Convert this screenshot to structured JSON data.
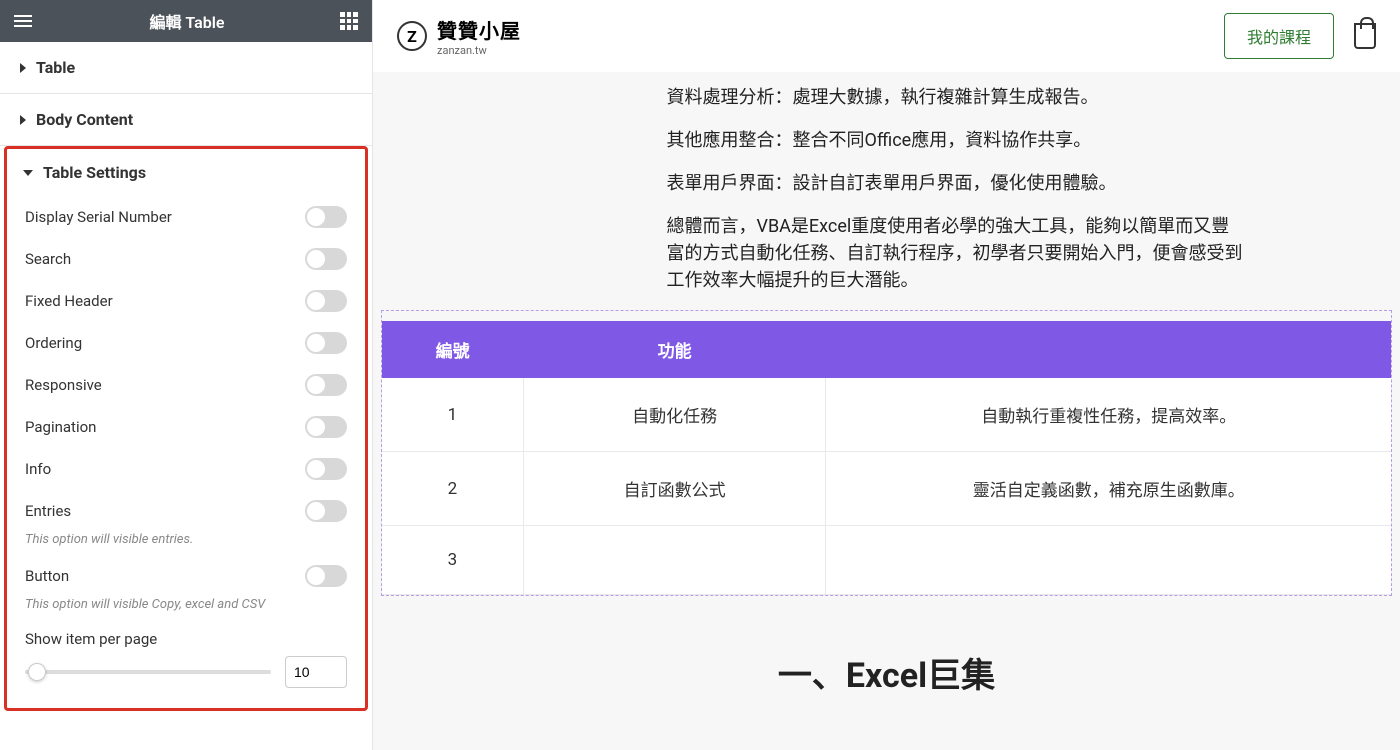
{
  "sidebar": {
    "title": "編輯 Table",
    "sections": {
      "table": "Table",
      "body_content": "Body Content",
      "table_settings": "Table Settings"
    },
    "settings": {
      "display_serial": "Display Serial Number",
      "search": "Search",
      "fixed_header": "Fixed Header",
      "ordering": "Ordering",
      "responsive": "Responsive",
      "pagination": "Pagination",
      "info": "Info",
      "entries": "Entries",
      "entries_help": "This option will visible entries.",
      "button": "Button",
      "button_help": "This option will visible Copy, excel and CSV",
      "show_per_page": "Show item per page",
      "per_page_value": "10"
    }
  },
  "topbar": {
    "brand_title": "贊贊小屋",
    "brand_sub": "zanzan.tw",
    "my_courses": "我的課程"
  },
  "article": {
    "p1": "資料處理分析：處理大數據，執行複雜計算生成報告。",
    "p2": "其他應用整合：整合不同Office應用，資料協作共享。",
    "p3": "表單用戶界面：設計自訂表單用戶界面，優化使用體驗。",
    "p4": "總體而言，VBA是Excel重度使用者必學的強大工具，能夠以簡單而又豐富的方式自動化任務、自訂執行程序，初學者只要開始入門，便會感受到工作效率大幅提升的巨大潛能。"
  },
  "table": {
    "headers": {
      "no": "編號",
      "func": "功能",
      "desc": ""
    },
    "rows": [
      {
        "no": "1",
        "func": "自動化任務",
        "desc": "自動執行重複性任務，提高效率。"
      },
      {
        "no": "2",
        "func": "自訂函數公式",
        "desc": "靈活自定義函數，補充原生函數庫。"
      },
      {
        "no": "3",
        "func": "",
        "desc": ""
      }
    ]
  },
  "section_title": "一、Excel巨集"
}
